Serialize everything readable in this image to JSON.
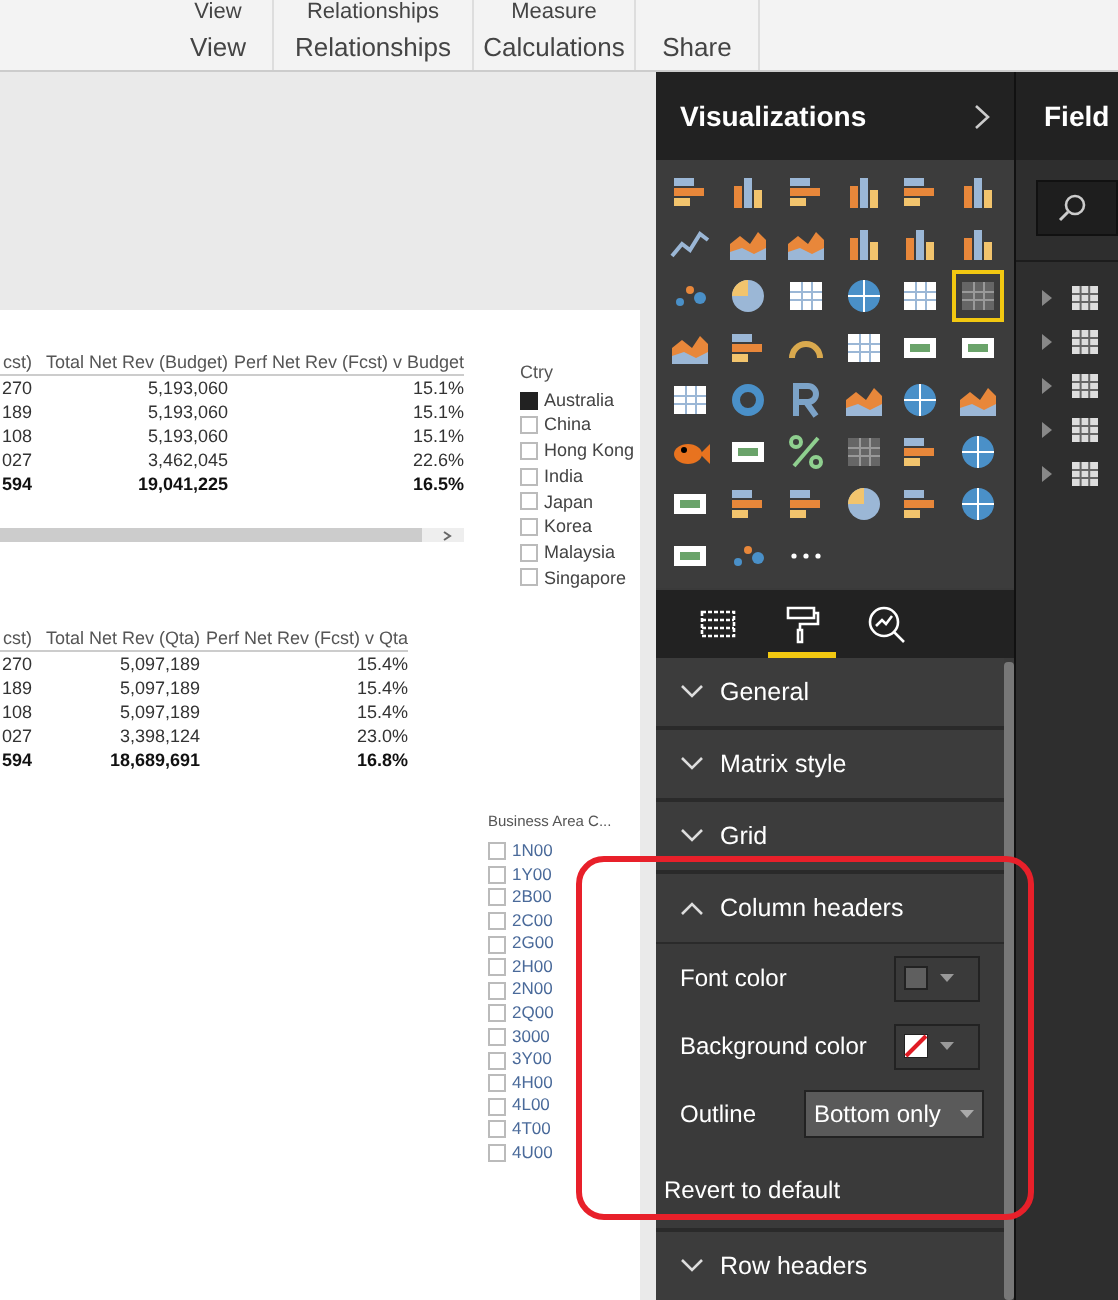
{
  "ribbon": {
    "top_labels": [
      "View",
      "Relationships",
      "Measure"
    ],
    "groups": [
      "View",
      "Relationships",
      "Calculations",
      "Share"
    ]
  },
  "tables": [
    {
      "columns": [
        "cst)",
        "Total Net Rev (Budget)",
        "Perf Net Rev (Fcst) v Budget"
      ],
      "rows": [
        {
          "cells": [
            "270",
            "5,193,060",
            "15.1%"
          ],
          "total": false
        },
        {
          "cells": [
            "189",
            "5,193,060",
            "15.1%"
          ],
          "total": false
        },
        {
          "cells": [
            "108",
            "5,193,060",
            "15.1%"
          ],
          "total": false
        },
        {
          "cells": [
            "027",
            "3,462,045",
            "22.6%"
          ],
          "total": false
        },
        {
          "cells": [
            "594",
            "19,041,225",
            "16.5%"
          ],
          "total": true
        }
      ]
    },
    {
      "columns": [
        "cst)",
        "Total Net Rev (Qta)",
        "Perf Net Rev (Fcst) v Qta"
      ],
      "rows": [
        {
          "cells": [
            "270",
            "5,097,189",
            "15.4%"
          ],
          "total": false
        },
        {
          "cells": [
            "189",
            "5,097,189",
            "15.4%"
          ],
          "total": false
        },
        {
          "cells": [
            "108",
            "5,097,189",
            "15.4%"
          ],
          "total": false
        },
        {
          "cells": [
            "027",
            "3,398,124",
            "23.0%"
          ],
          "total": false
        },
        {
          "cells": [
            "594",
            "18,689,691",
            "16.8%"
          ],
          "total": true
        }
      ]
    }
  ],
  "country_slicer": {
    "title": "Ctry",
    "items": [
      {
        "label": "Australia",
        "checked": true
      },
      {
        "label": "China",
        "checked": false
      },
      {
        "label": "Hong Kong",
        "checked": false
      },
      {
        "label": "India",
        "checked": false
      },
      {
        "label": "Japan",
        "checked": false
      },
      {
        "label": "Korea",
        "checked": false
      },
      {
        "label": "Malaysia",
        "checked": false
      },
      {
        "label": "Singapore",
        "checked": false
      }
    ]
  },
  "business_area_slicer": {
    "title": "Business Area C...",
    "items": [
      {
        "label": "1N00",
        "checked": false
      },
      {
        "label": "1Y00",
        "checked": false
      },
      {
        "label": "2B00",
        "checked": false
      },
      {
        "label": "2C00",
        "checked": false
      },
      {
        "label": "2G00",
        "checked": false
      },
      {
        "label": "2H00",
        "checked": false
      },
      {
        "label": "2N00",
        "checked": false
      },
      {
        "label": "2Q00",
        "checked": false
      },
      {
        "label": "3000",
        "checked": false
      },
      {
        "label": "3Y00",
        "checked": false
      },
      {
        "label": "4H00",
        "checked": false
      },
      {
        "label": "4L00",
        "checked": false
      },
      {
        "label": "4T00",
        "checked": false
      },
      {
        "label": "4U00",
        "checked": false
      }
    ]
  },
  "visualizations": {
    "title": "Visualizations",
    "visuals": [
      {
        "selected": false
      },
      {
        "selected": false
      },
      {
        "selected": false
      },
      {
        "selected": false
      },
      {
        "selected": false
      },
      {
        "selected": false
      },
      {
        "selected": false
      },
      {
        "selected": false
      },
      {
        "selected": false
      },
      {
        "selected": false
      },
      {
        "selected": false
      },
      {
        "selected": false
      },
      {
        "selected": false
      },
      {
        "selected": false
      },
      {
        "selected": false
      },
      {
        "selected": false
      },
      {
        "selected": false
      },
      {
        "selected": true
      },
      {
        "selected": false
      },
      {
        "selected": false
      },
      {
        "selected": false
      },
      {
        "selected": false
      },
      {
        "selected": false
      },
      {
        "selected": false
      },
      {
        "selected": false
      },
      {
        "selected": false
      },
      {
        "selected": false
      },
      {
        "selected": false
      },
      {
        "selected": false
      },
      {
        "selected": false
      },
      {
        "selected": false
      },
      {
        "selected": false
      },
      {
        "selected": false
      },
      {
        "selected": false
      },
      {
        "selected": false
      },
      {
        "selected": false
      },
      {
        "selected": false
      },
      {
        "selected": false
      },
      {
        "selected": false
      },
      {
        "selected": false
      },
      {
        "selected": false
      },
      {
        "selected": false
      },
      {
        "selected": false
      },
      {
        "selected": false
      },
      {
        "selected": false
      }
    ],
    "pane_tabs": [
      {
        "selected": false
      },
      {
        "selected": true
      },
      {
        "selected": false
      }
    ],
    "sections": [
      {
        "label": "General",
        "expanded": false
      },
      {
        "label": "Matrix style",
        "expanded": false
      },
      {
        "label": "Grid",
        "expanded": false
      },
      {
        "label": "Column headers",
        "expanded": true,
        "settings": [
          {
            "kind": "color",
            "label": "Font color",
            "color": "#5f5f5f"
          },
          {
            "kind": "nocolor",
            "label": "Background color"
          },
          {
            "kind": "dropdown",
            "label": "Outline",
            "value": "Bottom only"
          }
        ],
        "revert": "Revert to default"
      },
      {
        "label": "Row headers",
        "expanded": false
      }
    ]
  },
  "fields": {
    "title": "Field",
    "tables": [
      {
        "expanded": false
      },
      {
        "expanded": false
      },
      {
        "expanded": false
      },
      {
        "expanded": false
      },
      {
        "expanded": false
      }
    ]
  }
}
